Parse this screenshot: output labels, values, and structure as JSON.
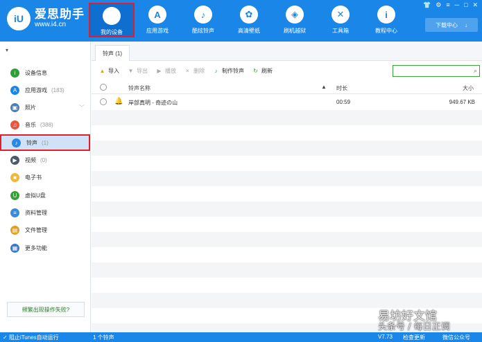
{
  "app": {
    "logo_mark": "iU",
    "name": "爱思助手",
    "url": "www.i4.cn"
  },
  "nav": [
    {
      "label": "我的设备",
      "icon": "apple-icon",
      "glyph": "",
      "active": true
    },
    {
      "label": "应用游戏",
      "icon": "app-store-icon",
      "glyph": "A"
    },
    {
      "label": "酷炫铃声",
      "icon": "bell-icon",
      "glyph": "♪"
    },
    {
      "label": "高清壁纸",
      "icon": "flower-icon",
      "glyph": "✿"
    },
    {
      "label": "刷机越狱",
      "icon": "box-icon",
      "glyph": "◈"
    },
    {
      "label": "工具箱",
      "icon": "tools-icon",
      "glyph": "✕"
    },
    {
      "label": "教程中心",
      "icon": "info-icon",
      "glyph": "i"
    }
  ],
  "download_center": "下载中心",
  "sidebar": {
    "items": [
      {
        "label": "设备信息",
        "count": "",
        "icon": "info-circle-icon",
        "color": "#2f9e3a",
        "glyph": "i"
      },
      {
        "label": "应用游戏",
        "count": "(183)",
        "icon": "app-store-icon",
        "color": "#1a86e8",
        "glyph": "A"
      },
      {
        "label": "照片",
        "count": "",
        "icon": "photo-icon",
        "color": "#4a7fb5",
        "glyph": "▣",
        "chevron": true
      },
      {
        "label": "音乐",
        "count": "(388)",
        "icon": "music-icon",
        "color": "#e8543e",
        "glyph": "♫"
      },
      {
        "label": "铃声",
        "count": "(1)",
        "icon": "bell-icon",
        "color": "#2a8ae0",
        "glyph": "♪",
        "active": true
      },
      {
        "label": "视频",
        "count": "(0)",
        "icon": "video-icon",
        "color": "#4a5a6a",
        "glyph": "▶"
      },
      {
        "label": "电子书",
        "count": "",
        "icon": "book-icon",
        "color": "#f0b838",
        "glyph": "■"
      },
      {
        "label": "虚拟U盘",
        "count": "",
        "icon": "usb-icon",
        "color": "#3a9e3a",
        "glyph": "U"
      },
      {
        "label": "资料管理",
        "count": "",
        "icon": "contacts-icon",
        "color": "#3a8ad8",
        "glyph": "≡"
      },
      {
        "label": "文件管理",
        "count": "",
        "icon": "file-icon",
        "color": "#e0a020",
        "glyph": "▤"
      },
      {
        "label": "更多功能",
        "count": "",
        "icon": "grid-icon",
        "color": "#3a7ac8",
        "glyph": "▦"
      }
    ],
    "fail_link": "频繁出现操作失败?"
  },
  "tab": {
    "label": "铃声 (1)"
  },
  "toolbar": [
    {
      "label": "导入",
      "icon": "import-icon",
      "glyph": "▲",
      "color": "#e0a020",
      "enabled": true
    },
    {
      "label": "导出",
      "icon": "export-icon",
      "glyph": "▼",
      "color": "#aaa",
      "enabled": false
    },
    {
      "label": "播放",
      "icon": "play-icon",
      "glyph": "▶",
      "color": "#aaa",
      "enabled": false
    },
    {
      "label": "删除",
      "icon": "delete-icon",
      "glyph": "×",
      "color": "#aaa",
      "enabled": false
    },
    {
      "label": "制作铃声",
      "icon": "make-ringtone-icon",
      "glyph": "♪",
      "color": "#1a86e8",
      "enabled": true
    },
    {
      "label": "刷新",
      "icon": "refresh-icon",
      "glyph": "↻",
      "color": "#2f9e3a",
      "enabled": true
    }
  ],
  "search": {
    "placeholder": ""
  },
  "table": {
    "headers": {
      "name": "铃声名称",
      "duration": "时长",
      "size": "大小"
    },
    "rows": [
      {
        "name": "岸部真明 - 奇迹の山",
        "duration": "00:59",
        "size": "949.67 KB"
      }
    ]
  },
  "status": {
    "itunes": "阻止iTunes自动运行",
    "count": "1 个铃声",
    "version": "V7.73",
    "check_update": "检查更新",
    "wechat": "微信公众号"
  },
  "watermark": {
    "line1": "易坊好文馆",
    "line2": "头条号 / 每日正调"
  }
}
